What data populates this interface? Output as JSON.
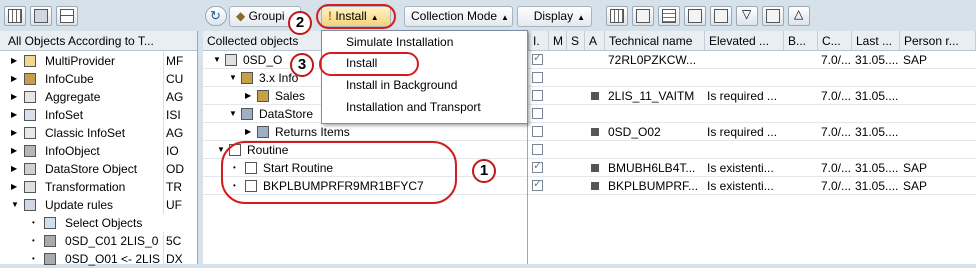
{
  "toolbar_left": {
    "icons": [
      "grid-icon",
      "save-icon",
      "hierarchy-icon"
    ]
  },
  "left_panel": {
    "header": "All Objects According to T...",
    "items": [
      {
        "label": "MultiProvider",
        "code": "MF",
        "icon": "multiprovider-icon"
      },
      {
        "label": "InfoCube",
        "code": "CU",
        "icon": "infocube-icon"
      },
      {
        "label": "Aggregate",
        "code": "AG",
        "icon": "aggregate-icon"
      },
      {
        "label": "InfoSet",
        "code": "ISI",
        "icon": "infoset-icon"
      },
      {
        "label": "Classic InfoSet",
        "code": "AG",
        "icon": "classic-infoset-icon"
      },
      {
        "label": "InfoObject",
        "code": "IO",
        "icon": "infoobject-icon"
      },
      {
        "label": "DataStore Object",
        "code": "OD",
        "icon": "datastore-icon"
      },
      {
        "label": "Transformation",
        "code": "TR",
        "icon": "transformation-icon"
      },
      {
        "label": "Update rules",
        "code": "UF",
        "icon": "update-rules-icon"
      },
      {
        "label": "Select Objects",
        "code": "",
        "icon": "select-objects-icon"
      },
      {
        "label": "0SD_C01 2LIS_0",
        "code": "5C",
        "icon": "update-rule-icon"
      },
      {
        "label": "0SD_O01 <- 2LIS",
        "code": "DX",
        "icon": "update-rule-icon"
      }
    ]
  },
  "main_toolbar": {
    "grouping": "Groupi",
    "install": "Install",
    "collection_mode": "Collection Mode",
    "display": "Display"
  },
  "install_menu": {
    "items": [
      "Simulate Installation",
      "Install",
      "Install in Background",
      "Installation and Transport"
    ]
  },
  "grid": {
    "headers": [
      "Collected objects",
      "I.",
      "M",
      "S",
      "A",
      "Technical name",
      "Elevated ...",
      "B...",
      "C...",
      "Last ...",
      "Person r..."
    ],
    "rows": [
      {
        "name": "0SD_O",
        "tech": "72RL0PZKCW...",
        "elevated": "",
        "c": "7.0/...",
        "last": "31.05....",
        "person": "SAP",
        "i_checked": true
      },
      {
        "name": "3.x Info",
        "tech": "",
        "elevated": "",
        "c": "",
        "last": "",
        "person": "",
        "i_checked": false
      },
      {
        "name": "Sales",
        "tech": "2LIS_11_VAITM",
        "elevated": "Is required ...",
        "c": "7.0/...",
        "last": "31.05....",
        "person": "",
        "i_checked": false
      },
      {
        "name": "DataStore",
        "tech": "",
        "elevated": "",
        "c": "",
        "last": "",
        "person": "",
        "i_checked": false
      },
      {
        "name": "Returns Items",
        "tech": "0SD_O02",
        "elevated": "Is required ...",
        "c": "7.0/...",
        "last": "31.05....",
        "person": "",
        "i_checked": false
      },
      {
        "name": "Routine",
        "tech": "",
        "elevated": "",
        "c": "",
        "last": "",
        "person": "",
        "i_checked": false
      },
      {
        "name": "Start Routine",
        "tech": "BMUBH6LB4T...",
        "elevated": "Is existenti...",
        "c": "7.0/...",
        "last": "31.05....",
        "person": "SAP",
        "i_checked": true
      },
      {
        "name": "BKPLBUMPRFR9MR1BFYC7",
        "tech": "BKPLBUMPRF...",
        "elevated": "Is existenti...",
        "c": "7.0/...",
        "last": "31.05....",
        "person": "SAP",
        "i_checked": true
      }
    ]
  },
  "annotations": {
    "one": "1",
    "two": "2",
    "three": "3"
  },
  "colors": {
    "accent_red": "#d51d1d",
    "header_bg": "#e9eef3",
    "toolbar_bg": "#d7e1ea"
  }
}
